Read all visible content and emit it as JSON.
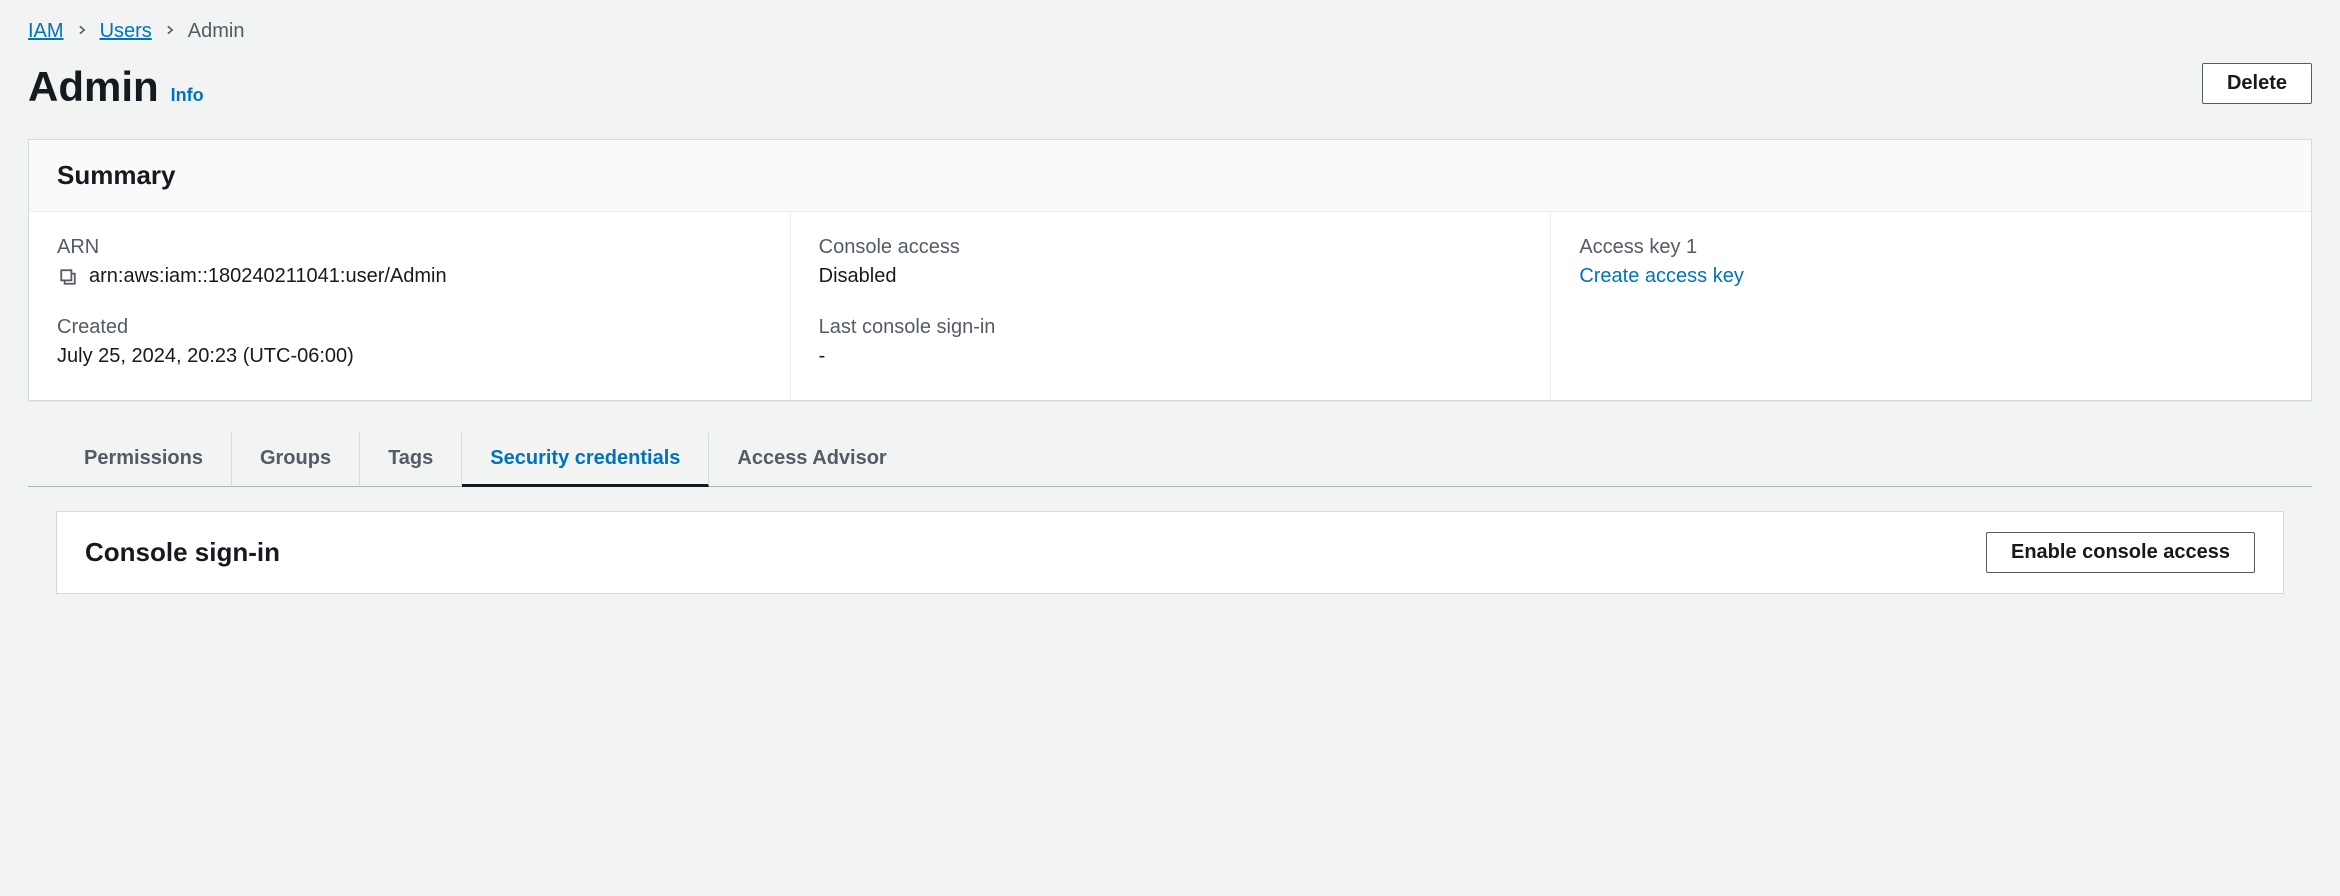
{
  "breadcrumb": {
    "items": [
      {
        "label": "IAM",
        "link": true
      },
      {
        "label": "Users",
        "link": true
      },
      {
        "label": "Admin",
        "link": false
      }
    ]
  },
  "header": {
    "title": "Admin",
    "info_label": "Info",
    "delete_label": "Delete"
  },
  "summary": {
    "title": "Summary",
    "arn": {
      "label": "ARN",
      "value": "arn:aws:iam::180240211041:user/Admin"
    },
    "created": {
      "label": "Created",
      "value": "July 25, 2024, 20:23 (UTC-06:00)"
    },
    "console_access": {
      "label": "Console access",
      "value": "Disabled"
    },
    "last_signin": {
      "label": "Last console sign-in",
      "value": "-"
    },
    "access_key": {
      "label": "Access key 1",
      "link_label": "Create access key"
    }
  },
  "tabs": [
    {
      "label": "Permissions",
      "active": false
    },
    {
      "label": "Groups",
      "active": false
    },
    {
      "label": "Tags",
      "active": false
    },
    {
      "label": "Security credentials",
      "active": true
    },
    {
      "label": "Access Advisor",
      "active": false
    }
  ],
  "console_signin": {
    "title": "Console sign-in",
    "button_label": "Enable console access"
  }
}
